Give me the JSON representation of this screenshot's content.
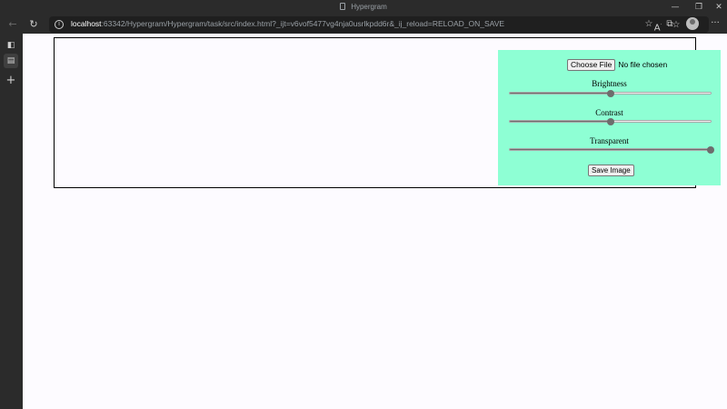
{
  "window": {
    "title": "Hypergram",
    "icon": "document-icon",
    "controls": {
      "minimize": "—",
      "maximize": "❐",
      "close": "✕"
    }
  },
  "toolbar": {
    "url_host": "localhost",
    "url_rest": ":63342/Hypergram/Hypergram/task/src/index.html?_ijt=v6vof5477vg4nja0usrlkpdd6r&_ij_reload=RELOAD_ON_SAVE",
    "icons": [
      "back-arrow-icon",
      "reload-icon",
      "site-info-icon",
      "read-aloud-icon",
      "add-favorite-icon",
      "favorites-icon",
      "collections-icon",
      "profile-icon",
      "more-icon"
    ]
  },
  "sidebar": {
    "icons": [
      "tab-actions-icon",
      "tab-page-icon",
      "new-tab-icon"
    ]
  },
  "editor": {
    "choose_file_label": "Choose File",
    "file_status": "No file chosen",
    "sliders": [
      {
        "label": "Brightness",
        "value": 0.5
      },
      {
        "label": "Contrast",
        "value": 0.5
      },
      {
        "label": "Transparent",
        "value": 1.0
      }
    ],
    "save_label": "Save Image"
  },
  "colors": {
    "panel_bg": "#8effd4",
    "page_bg": "#fdfbff",
    "chrome_bg": "#2b2b2b"
  }
}
